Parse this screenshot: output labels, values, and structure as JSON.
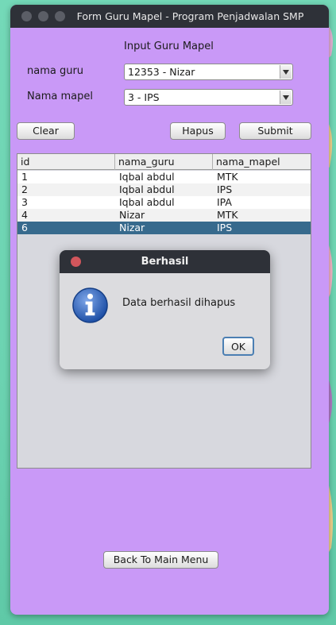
{
  "window": {
    "title": "Form Guru Mapel - Program Penjadwalan SMP"
  },
  "form": {
    "heading": "Input Guru Mapel",
    "guru_label": "nama guru",
    "guru_value": "12353 - Nizar",
    "mapel_label": "Nama mapel",
    "mapel_value": "3 - IPS"
  },
  "buttons": {
    "clear": "Clear",
    "hapus": "Hapus",
    "submit": "Submit",
    "back": "Back To Main Menu"
  },
  "table": {
    "columns": [
      "id",
      "nama_guru",
      "nama_mapel"
    ],
    "rows": [
      {
        "id": "1",
        "nama_guru": "Iqbal abdul",
        "nama_mapel": "MTK",
        "selected": false
      },
      {
        "id": "2",
        "nama_guru": "Iqbal abdul",
        "nama_mapel": "IPS",
        "selected": false
      },
      {
        "id": "3",
        "nama_guru": "Iqbal abdul",
        "nama_mapel": "IPA",
        "selected": false
      },
      {
        "id": "4",
        "nama_guru": "Nizar",
        "nama_mapel": "MTK",
        "selected": false
      },
      {
        "id": "6",
        "nama_guru": "Nizar",
        "nama_mapel": "IPS",
        "selected": true
      }
    ]
  },
  "dialog": {
    "title": "Berhasil",
    "message": "Data berhasil dihapus",
    "ok": "OK",
    "icon": "info-icon"
  },
  "colors": {
    "window_bg": "#c999f7",
    "titlebar": "#2e3138",
    "selection": "#376a8d",
    "desktop": "#6cd3b1"
  }
}
